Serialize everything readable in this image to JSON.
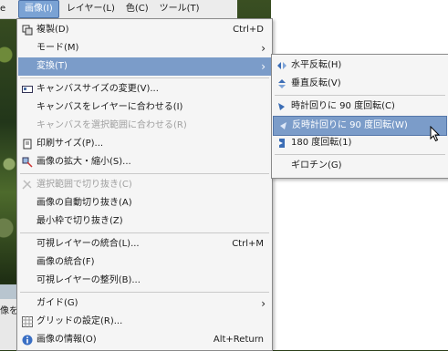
{
  "menubar": {
    "items": [
      {
        "label": "e"
      },
      {
        "label": "画像(I)"
      },
      {
        "label": "レイヤー(L)"
      },
      {
        "label": "色(C)"
      },
      {
        "label": "ツール(T)"
      }
    ]
  },
  "image_menu": {
    "items": [
      {
        "label": "複製(D)",
        "accel": "Ctrl+D",
        "icon": "duplicate-icon"
      },
      {
        "label": "モード(M)",
        "submenu": "›"
      },
      {
        "label": "変換(T)",
        "submenu": "›"
      },
      {
        "label": "キャンバスサイズの変更(V)...",
        "icon": "canvas-size-icon"
      },
      {
        "label": "キャンバスをレイヤーに合わせる(I)"
      },
      {
        "label": "キャンバスを選択範囲に合わせる(R)"
      },
      {
        "label": "印刷サイズ(P)...",
        "icon": "print-size-icon"
      },
      {
        "label": "画像の拡大・縮小(S)...",
        "icon": "scale-image-icon"
      },
      {
        "label": "選択範囲で切り抜き(C)",
        "icon": "crop-icon"
      },
      {
        "label": "画像の自動切り抜き(A)"
      },
      {
        "label": "最小枠で切り抜き(Z)"
      },
      {
        "label": "可視レイヤーの統合(L)...",
        "accel": "Ctrl+M"
      },
      {
        "label": "画像の統合(F)"
      },
      {
        "label": "可視レイヤーの整列(B)..."
      },
      {
        "label": "ガイド(G)",
        "submenu": "›"
      },
      {
        "label": "グリッドの設定(R)...",
        "icon": "grid-icon"
      },
      {
        "label": "画像の情報(O)",
        "accel": "Alt+Return",
        "icon": "info-icon"
      }
    ]
  },
  "transform_menu": {
    "items": [
      {
        "label": "水平反転(H)",
        "icon": "flip-horizontal-icon"
      },
      {
        "label": "垂直反転(V)",
        "icon": "flip-vertical-icon"
      },
      {
        "label": "時計回りに 90 度回転(C)",
        "icon": "rotate-cw-icon"
      },
      {
        "label": "反時計回りに 90 度回転(W)",
        "icon": "rotate-ccw-icon"
      },
      {
        "label": "180 度回転(1)",
        "icon": "rotate-180-icon"
      },
      {
        "label": "ギロチン(G)"
      }
    ]
  },
  "background_text": "像を成",
  "colors": {
    "highlight": "#7b9cc9",
    "menubar_active": "#7aa2d4"
  }
}
